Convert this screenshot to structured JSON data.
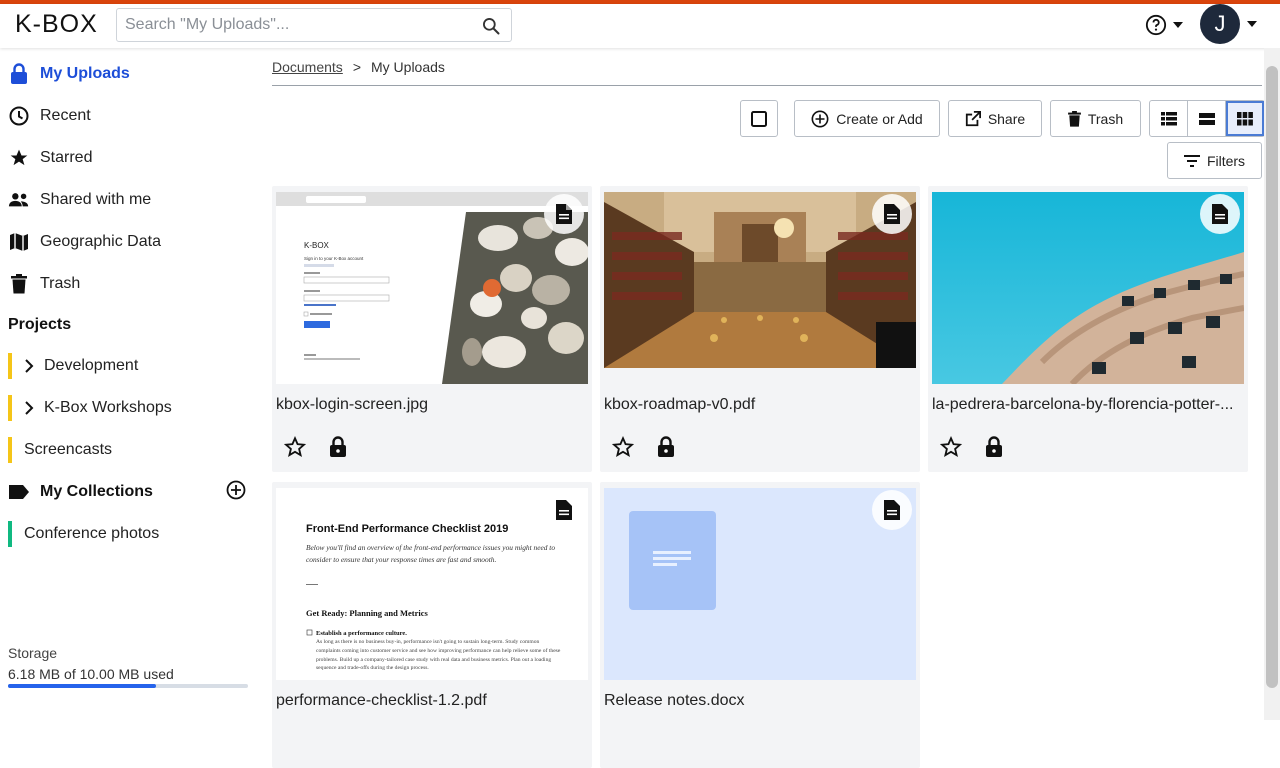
{
  "app": {
    "logo": "K-BOX"
  },
  "search": {
    "placeholder": "Search \"My Uploads\"..."
  },
  "header": {
    "avatar_initial": "J"
  },
  "sidebar": {
    "items": [
      {
        "label": "My Uploads",
        "icon": "lock-icon",
        "active": true
      },
      {
        "label": "Recent",
        "icon": "clock-icon"
      },
      {
        "label": "Starred",
        "icon": "star-icon"
      },
      {
        "label": "Shared with me",
        "icon": "people-icon"
      },
      {
        "label": "Geographic Data",
        "icon": "map-icon"
      },
      {
        "label": "Trash",
        "icon": "trash-icon"
      }
    ],
    "projects_title": "Projects",
    "projects": [
      {
        "label": "Development",
        "expandable": true
      },
      {
        "label": "K-Box Workshops",
        "expandable": true
      },
      {
        "label": "Screencasts",
        "expandable": false
      }
    ],
    "collections_title": "My Collections",
    "collections": [
      {
        "label": "Conference photos"
      }
    ],
    "storage": {
      "label": "Storage",
      "text": "6.18 MB of 10.00 MB used",
      "used_fraction": 0.618
    }
  },
  "breadcrumb": {
    "root": "Documents",
    "separator": ">",
    "current": "My Uploads"
  },
  "toolbar": {
    "create_label": "Create or Add",
    "share_label": "Share",
    "trash_label": "Trash",
    "filters_label": "Filters"
  },
  "documents": [
    {
      "name": "kbox-login-screen.jpg"
    },
    {
      "name": "kbox-roadmap-v0.pdf"
    },
    {
      "name": "la-pedrera-barcelona-by-florencia-potter-..."
    },
    {
      "name": "performance-checklist-1.2.pdf"
    },
    {
      "name": "Release notes.docx"
    }
  ],
  "thumb_texts": {
    "login_title": "K-BOX",
    "login_sub": "Sign in to your K-Box account",
    "checklist_title": "Front-End Performance Checklist 2019",
    "checklist_intro": "Below you'll find an overview of the front-end performance issues you might need to consider to ensure that your response times are fast and smooth.",
    "checklist_heading": "Get Ready: Planning and Metrics",
    "checklist_item": "Establish a performance culture.",
    "checklist_body": "As long as there is no business buy-in, performance isn't going to sustain long-term. Study common complaints coming into customer service and see how improving performance can help relieve some of these problems. Build up a company-tailored case study with real data and business metrics. Plan out a loading sequence and trade-offs during the design process."
  },
  "colors": {
    "accent": "#1d4ed8",
    "stripe": "#d9440c",
    "project": "#f5c518",
    "collection": "#10b981"
  }
}
